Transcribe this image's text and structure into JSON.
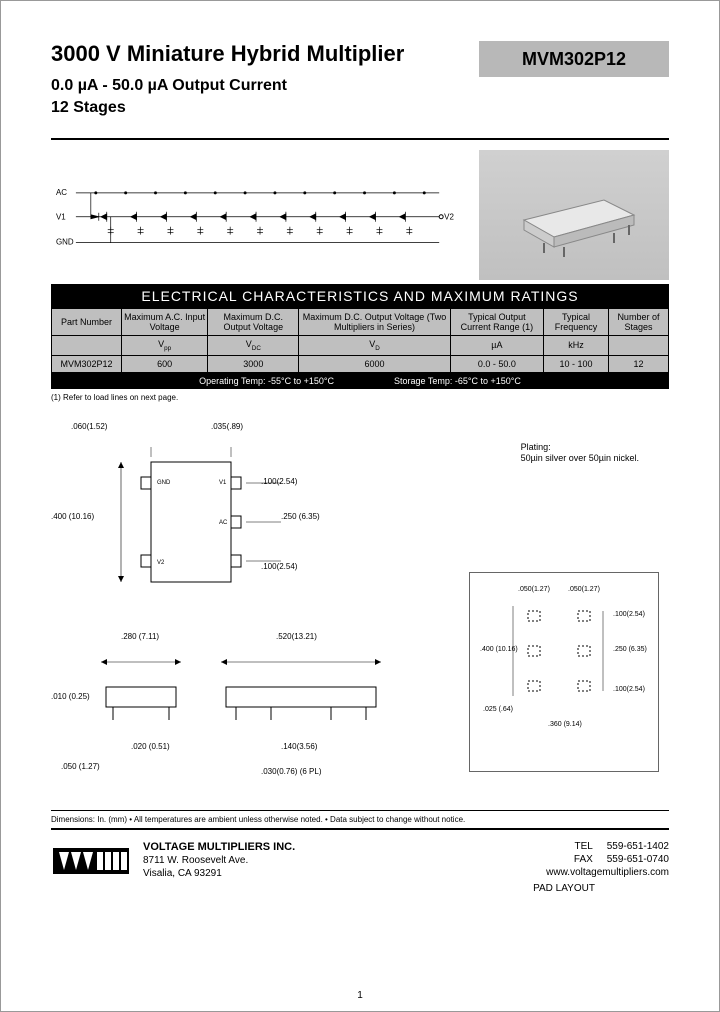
{
  "header": {
    "title": "3000 V Miniature Hybrid Multiplier",
    "part_number": "MVM302P12",
    "subtitle1": "0.0 µA - 50.0 µA Output Current",
    "subtitle2": "12 Stages"
  },
  "schematic": {
    "labels": {
      "ac": "AC",
      "v1": "V1",
      "gnd": "GND",
      "v2": "V2"
    }
  },
  "table": {
    "title": "ELECTRICAL CHARACTERISTICS AND MAXIMUM RATINGS",
    "headers": {
      "pn": "Part Number",
      "ac_in": "Maximum A.C. Input Voltage",
      "dc_out": "Maximum D.C. Output Voltage",
      "dc_out2": "Maximum D.C. Output Voltage (Two Multipliers in Series)",
      "out_cur": "Typical Output Current Range (1)",
      "freq": "Typical Frequency",
      "stages": "Number of Stages"
    },
    "units": {
      "ac_in": "Vpp",
      "dc_out": "VDC",
      "dc_out2": "VD",
      "out_cur": "µA",
      "freq": "kHz",
      "stages": ""
    },
    "row": {
      "pn": "MVM302P12",
      "ac_in": "600",
      "dc_out": "3000",
      "dc_out2": "6000",
      "out_cur": "0.0 - 50.0",
      "freq": "10 - 100",
      "stages": "12"
    },
    "temp": {
      "op": "Operating Temp: -55°C to +150°C",
      "storage": "Storage Temp: -65°C to +150°C"
    },
    "footnote": "(1) Refer to load lines on next page."
  },
  "drawings": {
    "plating_line1": "Plating:",
    "plating_line2": "50µin silver over 50µin nickel.",
    "dims": {
      "d060": ".060(1.52)",
      "d035": ".035(.89)",
      "d400": ".400 (10.16)",
      "d100": ".100(2.54)",
      "d250": ".250 (6.35)",
      "d280": ".280 (7.11)",
      "d520": ".520(13.21)",
      "d010": ".010 (0.25)",
      "d020": ".020 (0.51)",
      "d050": ".050 (1.27)",
      "d140": ".140(3.56)",
      "d030": ".030(0.76) (6 PL)",
      "d050b": ".050(1.27)",
      "d025": ".025 (.64)",
      "d360": ".360 (9.14)"
    },
    "pad_layout_title": "PAD LAYOUT"
  },
  "notes": {
    "dimensions": "Dimensions: In. (mm) • All temperatures are ambient unless otherwise noted. • Data subject to change without notice."
  },
  "footer": {
    "company": "VOLTAGE MULTIPLIERS INC.",
    "addr1": "8711 W. Roosevelt Ave.",
    "addr2": "Visalia, CA 93291",
    "tel_label": "TEL",
    "tel": "559-651-1402",
    "fax_label": "FAX",
    "fax": "559-651-0740",
    "web": "www.voltagemultipliers.com",
    "page": "1"
  }
}
